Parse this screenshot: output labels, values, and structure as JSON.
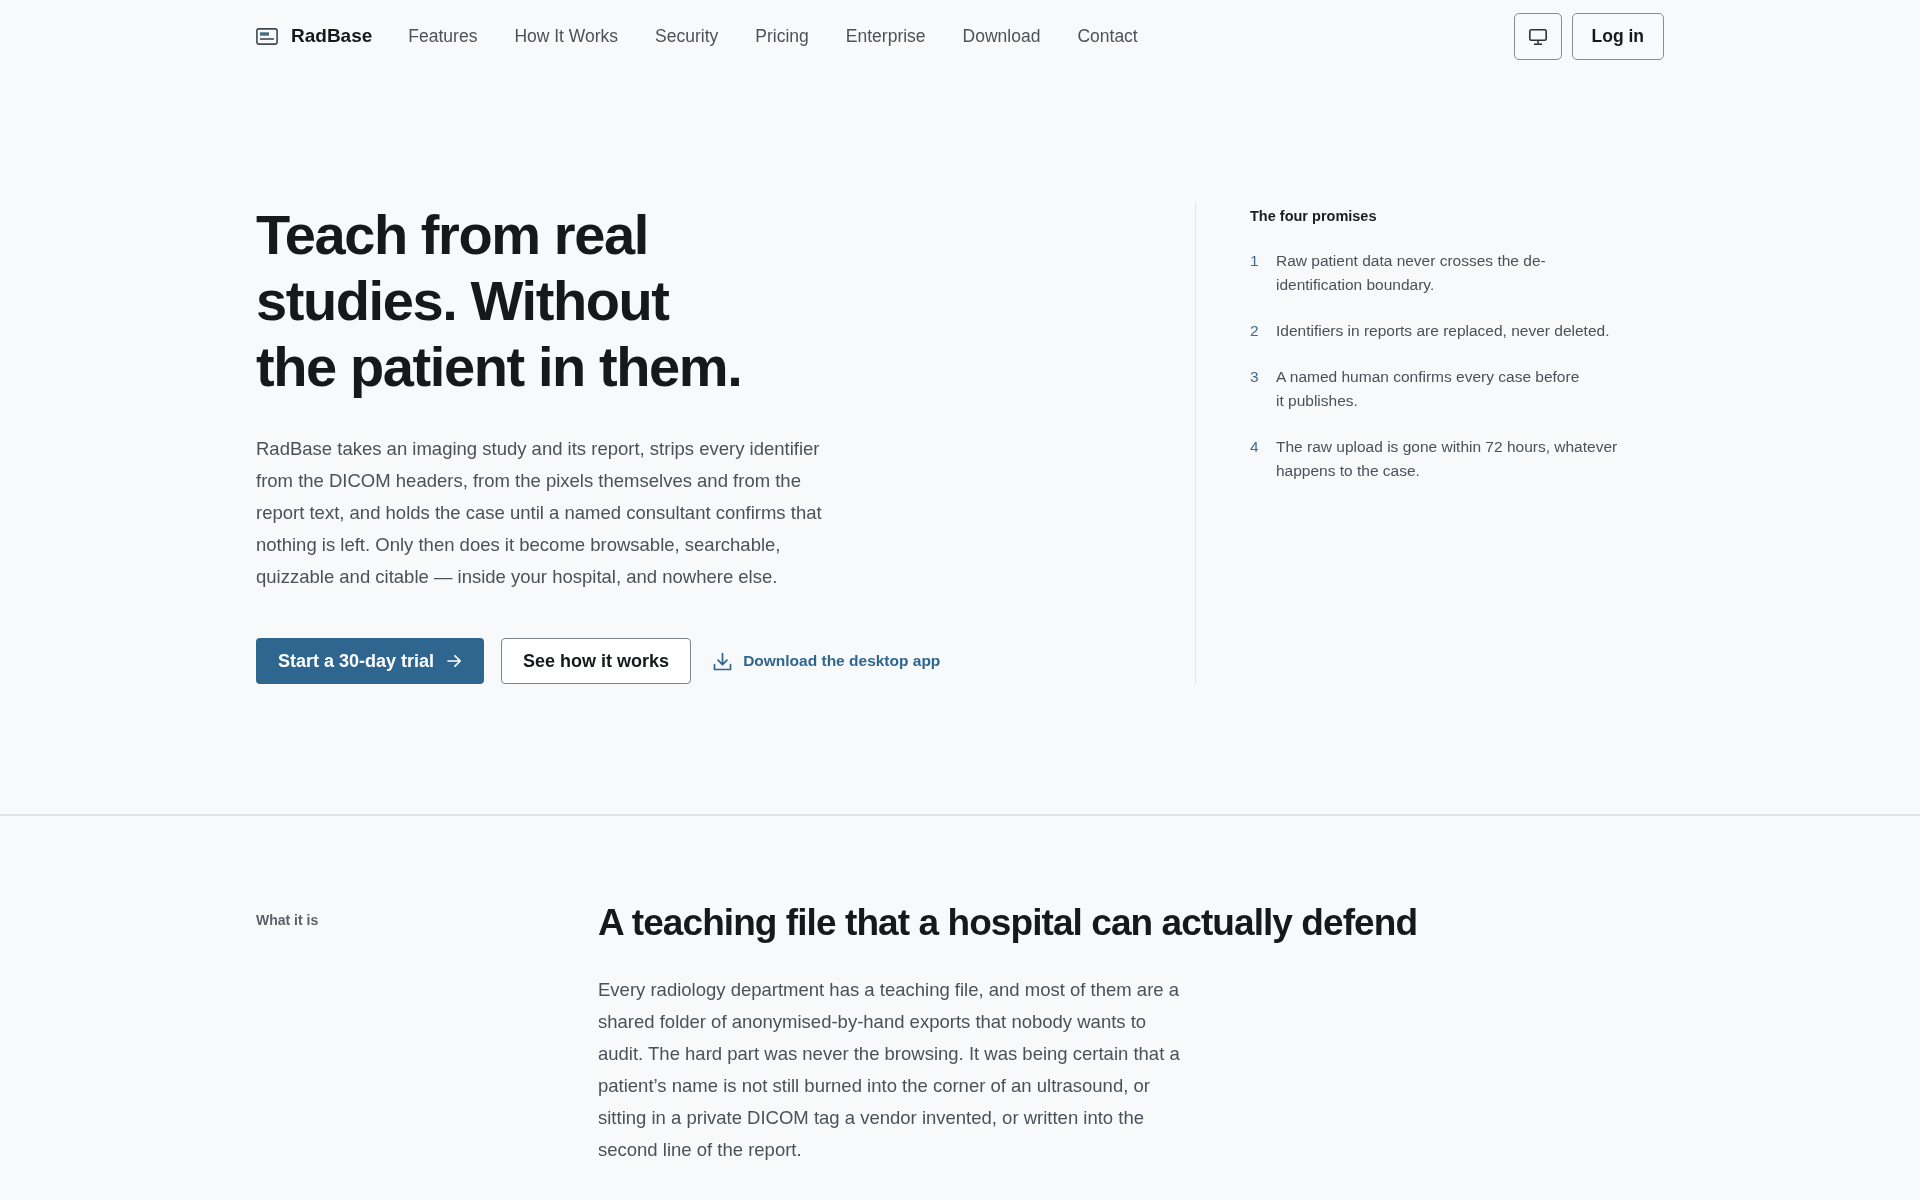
{
  "header": {
    "brand": "RadBase",
    "nav_links": [
      "Features",
      "How It Works",
      "Security",
      "Pricing",
      "Enterprise",
      "Download",
      "Contact"
    ],
    "login_button": "Log in"
  },
  "hero": {
    "heading": "Teach from real studies. Without the patient in them.",
    "intro": "RadBase takes an imaging study and its report, strips every identifier from the DICOM headers, from the pixels themselves and from the report text, and holds the case until a named consultant confirms that nothing is left. Only then does it become browsable, searchable, quizzable and citable — inside your hospital, and nowhere else.",
    "actions": [
      {
        "kind": "primary",
        "label": "Start a 30-day trial"
      },
      {
        "kind": "secondary",
        "label": "See how it works"
      },
      {
        "kind": "download",
        "label": "Download the desktop app"
      }
    ],
    "promises": {
      "title": "The four promises",
      "items": [
        {
          "number": "1",
          "text": "Raw patient data never crosses the de-identification boundary."
        },
        {
          "number": "2",
          "text": "Identifiers in reports are replaced, never deleted."
        },
        {
          "number": "3",
          "text": "A named human confirms every case before it publishes."
        },
        {
          "number": "4",
          "text": "The raw upload is gone within 72 hours, whatever happens to the case."
        }
      ]
    }
  },
  "what_it_is": {
    "label": "What it is",
    "heading": "A teaching file that a hospital can actually defend",
    "paragraphs": [
      "Every radiology department has a teaching file, and most of them are a shared folder of anonymised-by-hand exports that nobody wants to audit. The hard part was never the browsing. It was being certain that a patient’s name is not still burned into the corner of an ultrasound, or sitting in a private DICOM tag a vendor invented, or written into the second line of the report."
    ]
  }
}
